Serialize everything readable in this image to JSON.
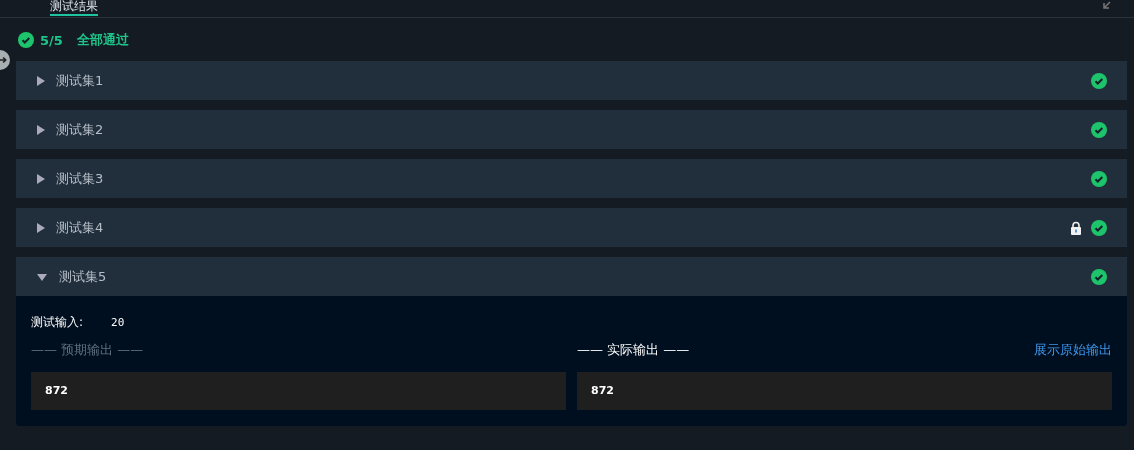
{
  "tabs": [
    {
      "label": "测试结果",
      "selected": true
    }
  ],
  "summary": {
    "count": "5/5",
    "status": "全部通过",
    "passed": true
  },
  "cases": [
    {
      "name": "测试集1",
      "expanded": false,
      "locked": false,
      "passed": true
    },
    {
      "name": "测试集2",
      "expanded": false,
      "locked": false,
      "passed": true
    },
    {
      "name": "测试集3",
      "expanded": false,
      "locked": false,
      "passed": true
    },
    {
      "name": "测试集4",
      "expanded": false,
      "locked": true,
      "passed": true
    },
    {
      "name": "测试集5",
      "expanded": true,
      "locked": false,
      "passed": true,
      "detail": {
        "input_label": "测试输入:",
        "input_value": "20",
        "expected_label": "—— 预期输出 ——",
        "actual_label": "—— 实际输出 ——",
        "raw_link": "展示原始输出",
        "expected_output": "872",
        "actual_output": "872"
      }
    }
  ]
}
